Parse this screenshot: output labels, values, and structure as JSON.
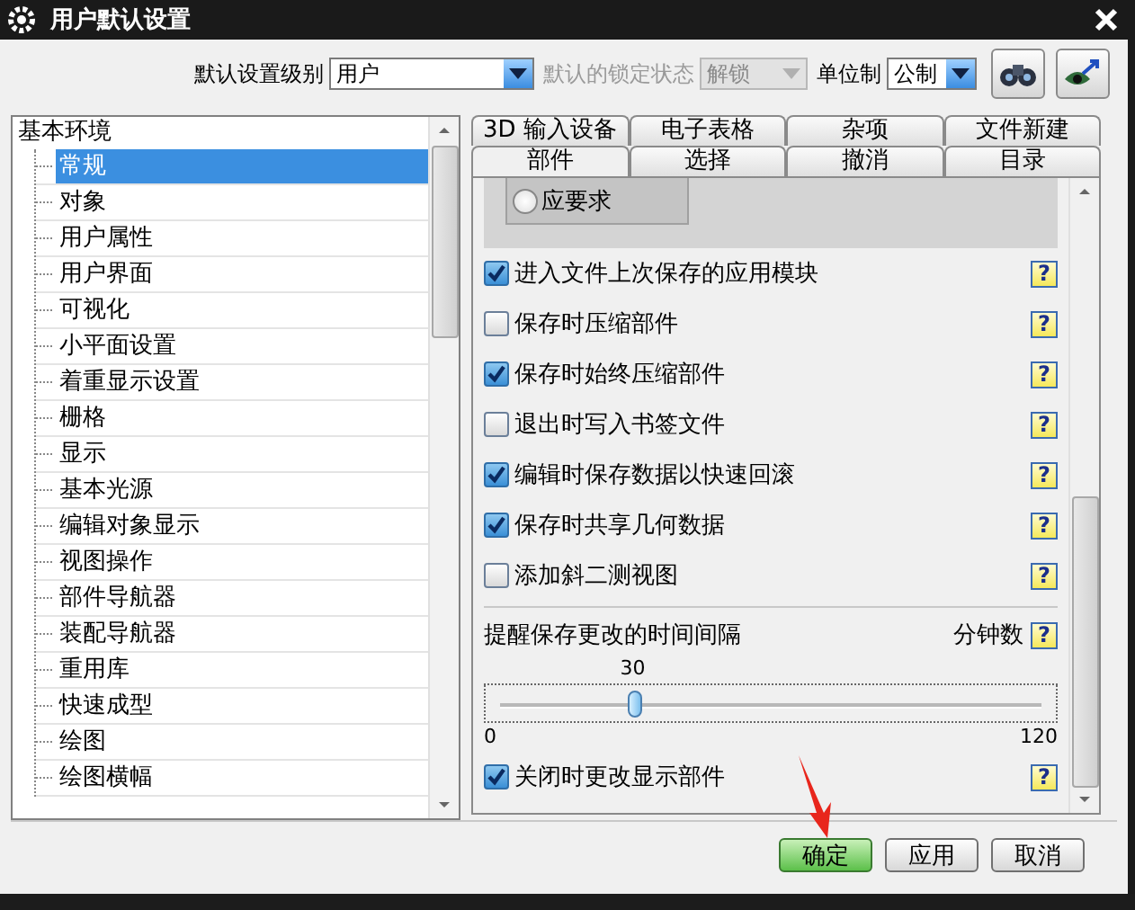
{
  "window": {
    "title": "用户默认设置"
  },
  "toolbar": {
    "level_label": "默认设置级别",
    "level_value": "用户",
    "lock_label": "默认的锁定状态",
    "lock_value": "解锁",
    "lock_disabled": true,
    "unit_label": "单位制",
    "unit_value": "公制"
  },
  "tree": {
    "root": "基本环境",
    "items": [
      {
        "label": "常规",
        "selected": true
      },
      {
        "label": "对象",
        "selected": false
      },
      {
        "label": "用户属性",
        "selected": false
      },
      {
        "label": "用户界面",
        "selected": false
      },
      {
        "label": "可视化",
        "selected": false
      },
      {
        "label": "小平面设置",
        "selected": false
      },
      {
        "label": "着重显示设置",
        "selected": false
      },
      {
        "label": "栅格",
        "selected": false
      },
      {
        "label": "显示",
        "selected": false
      },
      {
        "label": "基本光源",
        "selected": false
      },
      {
        "label": "编辑对象显示",
        "selected": false
      },
      {
        "label": "视图操作",
        "selected": false
      },
      {
        "label": "部件导航器",
        "selected": false
      },
      {
        "label": "装配导航器",
        "selected": false
      },
      {
        "label": "重用库",
        "selected": false
      },
      {
        "label": "快速成型",
        "selected": false
      },
      {
        "label": "绘图",
        "selected": false
      },
      {
        "label": "绘图横幅",
        "selected": false
      }
    ]
  },
  "tab_rows": [
    {
      "tabs": [
        {
          "label": "3D 输入设备",
          "selected": false
        },
        {
          "label": "电子表格",
          "selected": false
        },
        {
          "label": "杂项",
          "selected": false
        },
        {
          "label": "文件新建",
          "selected": false
        }
      ]
    },
    {
      "tabs": [
        {
          "label": "部件",
          "selected": true
        },
        {
          "label": "选择",
          "selected": false
        },
        {
          "label": "撤消",
          "selected": false
        },
        {
          "label": "目录",
          "selected": false
        }
      ]
    }
  ],
  "radio_option": {
    "label": "应要求",
    "selected": false
  },
  "options": [
    {
      "label": "进入文件上次保存的应用模块",
      "checked": true,
      "help": "?"
    },
    {
      "label": "保存时压缩部件",
      "checked": false,
      "help": "?"
    },
    {
      "label": "保存时始终压缩部件",
      "checked": true,
      "help": "?"
    },
    {
      "label": "退出时写入书签文件",
      "checked": false,
      "help": "?"
    },
    {
      "label": "编辑时保存数据以快速回滚",
      "checked": true,
      "help": "?"
    },
    {
      "label": "保存时共享几何数据",
      "checked": true,
      "help": "?"
    },
    {
      "label": "添加斜二测视图",
      "checked": false,
      "help": "?"
    }
  ],
  "interval": {
    "label": "提醒保存更改的时间间隔",
    "unit": "分钟数",
    "help": "?",
    "value": "30",
    "level": 0.25,
    "min": "0",
    "max": "120"
  },
  "last_option": {
    "label": "关闭时更改显示部件",
    "checked": true,
    "help": "?"
  },
  "buttons": [
    {
      "label": "确定",
      "default": true
    },
    {
      "label": "应用",
      "default": false
    },
    {
      "label": "取消",
      "default": false
    }
  ]
}
